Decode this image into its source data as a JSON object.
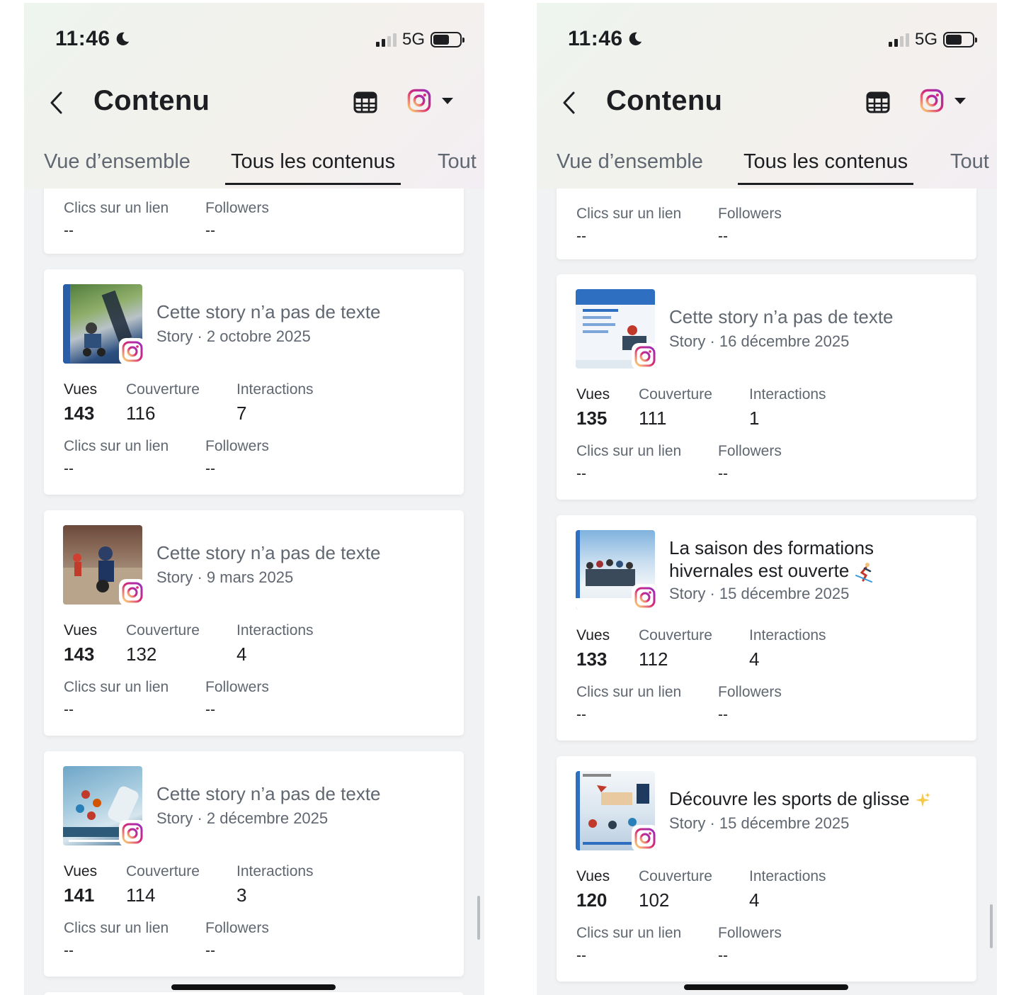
{
  "colors": {
    "ig_gradient_start": "#feda75",
    "ig_gradient_mid": "#d62976",
    "ig_gradient_end": "#962fbf",
    "text_primary": "#1c1e21",
    "text_secondary": "#606770"
  },
  "screens": [
    {
      "status": {
        "time": "11:46",
        "network": "5G",
        "icons": [
          "moon-icon",
          "signal-icon",
          "battery-icon"
        ]
      },
      "header": {
        "title": "Contenu",
        "back_icon": "chevron-left-icon",
        "table_icon": "table-icon",
        "account_icon": "instagram-icon",
        "dropdown_icon": "caret-down-icon"
      },
      "tabs": [
        "Vue d’ensemble",
        "Tous les contenus",
        "Tout"
      ],
      "partial_card": {
        "label_links": "Clics sur un lien",
        "label_followers": "Followers",
        "links": "--",
        "followers": "--"
      },
      "cards": [
        {
          "title": "Cette story n’a pas de texte",
          "subtitle": "Story · 2 octobre 2025",
          "label_views": "Vues",
          "label_reach": "Couverture",
          "label_interactions": "Interactions",
          "views": "143",
          "reach": "116",
          "interactions": "7",
          "label_links": "Clics sur un lien",
          "label_followers": "Followers",
          "links": "--",
          "followers": "--"
        },
        {
          "title": "Cette story n’a pas de texte",
          "subtitle": "Story · 9 mars 2025",
          "label_views": "Vues",
          "label_reach": "Couverture",
          "label_interactions": "Interactions",
          "views": "143",
          "reach": "132",
          "interactions": "4",
          "label_links": "Clics sur un lien",
          "label_followers": "Followers",
          "links": "--",
          "followers": "--"
        },
        {
          "title": "Cette story n’a pas de texte",
          "subtitle": "Story · 2 décembre 2025",
          "label_views": "Vues",
          "label_reach": "Couverture",
          "label_interactions": "Interactions",
          "views": "141",
          "reach": "114",
          "interactions": "3",
          "label_links": "Clics sur un lien",
          "label_followers": "Followers",
          "links": "--",
          "followers": "--"
        }
      ]
    },
    {
      "status": {
        "time": "11:46",
        "network": "5G",
        "icons": [
          "moon-icon",
          "signal-icon",
          "battery-icon"
        ]
      },
      "header": {
        "title": "Contenu",
        "back_icon": "chevron-left-icon",
        "table_icon": "table-icon",
        "account_icon": "instagram-icon",
        "dropdown_icon": "caret-down-icon"
      },
      "tabs": [
        "Vue d’ensemble",
        "Tous les contenus",
        "Tout"
      ],
      "partial_card": {
        "label_links": "Clics sur un lien",
        "label_followers": "Followers",
        "links": "--",
        "followers": "--"
      },
      "cards": [
        {
          "title": "Cette story n’a pas de texte",
          "subtitle": "Story · 16 décembre 2025",
          "label_views": "Vues",
          "label_reach": "Couverture",
          "label_interactions": "Interactions",
          "views": "135",
          "reach": "111",
          "interactions": "1",
          "label_links": "Clics sur un lien",
          "label_followers": "Followers",
          "links": "--",
          "followers": "--"
        },
        {
          "title": "La saison des formations hivernales est ouverte",
          "title_icon": "skier-icon",
          "subtitle": "Story · 15 décembre 2025",
          "label_views": "Vues",
          "label_reach": "Couverture",
          "label_interactions": "Interactions",
          "views": "133",
          "reach": "112",
          "interactions": "4",
          "label_links": "Clics sur un lien",
          "label_followers": "Followers",
          "links": "--",
          "followers": "--"
        },
        {
          "title": "Découvre les sports de glisse",
          "title_icon": "sparkles-icon",
          "subtitle": "Story · 15 décembre 2025",
          "label_views": "Vues",
          "label_reach": "Couverture",
          "label_interactions": "Interactions",
          "views": "120",
          "reach": "102",
          "interactions": "4",
          "label_links": "Clics sur un lien",
          "label_followers": "Followers",
          "links": "--",
          "followers": "--"
        }
      ]
    }
  ]
}
